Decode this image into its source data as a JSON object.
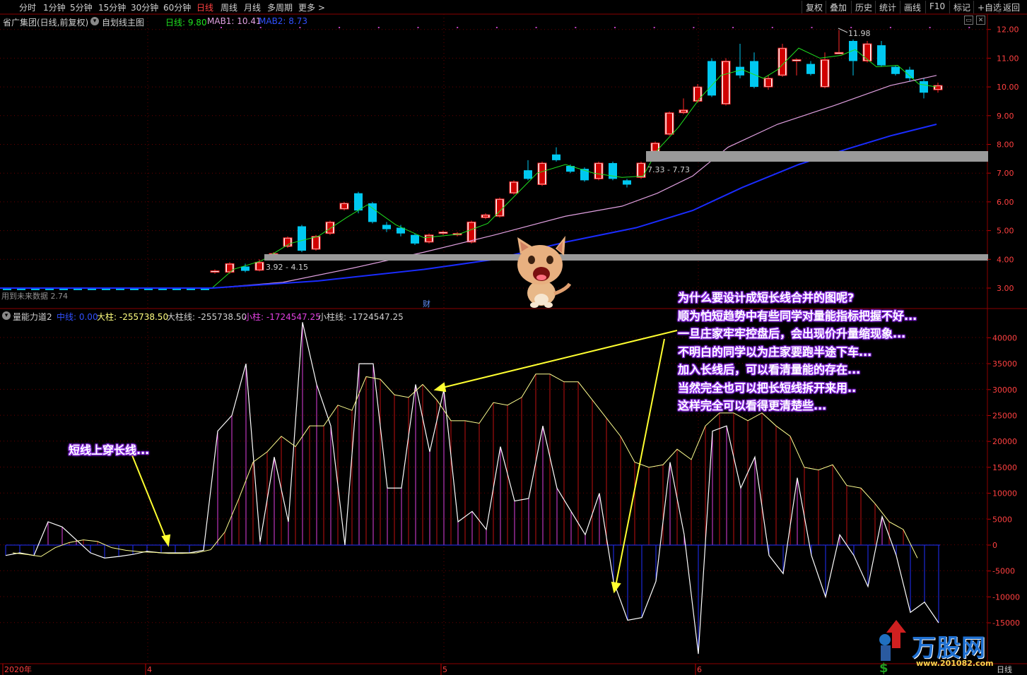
{
  "toolbar": {
    "periods": [
      "分时",
      "1分钟",
      "5分钟",
      "15分钟",
      "30分钟",
      "60分钟",
      "日线",
      "周线",
      "月线",
      "多周期",
      "更多 >"
    ],
    "active": "日线",
    "right": [
      "复权",
      "叠加",
      "历史",
      "统计",
      "画线",
      "F10",
      "标记",
      "+自选",
      "返回"
    ]
  },
  "main_header": {
    "stock": "省广集团(日线,前复权)",
    "template": "自划线主图",
    "ma_day": "日线: 9.80",
    "mab1": "MAB1: 10.41",
    "mab2": "MAB2: 8.73"
  },
  "price_axis": [
    "12.00",
    "11.00",
    "10.00",
    "9.00",
    "8.00",
    "7.00",
    "6.00",
    "5.00",
    "4.00",
    "3.00"
  ],
  "price_labels": {
    "high": "11.98",
    "band_low": "3.92 - 4.15",
    "band_high": "7.33 - 7.73",
    "bottom_left": "用到未来数据 2.74",
    "cai": "财"
  },
  "indicator_header": {
    "name": "量能力道2",
    "mid": "中线: 0.00",
    "dazhu": "大柱: -255738.50",
    "dazhuxian": "大柱线: -255738.50",
    "xiaozhu": "小柱: -1724547.25",
    "xiaozhuxian": "小柱线: -1724547.25"
  },
  "indicator_axis": [
    "40000",
    "35000",
    "30000",
    "25000",
    "20000",
    "15000",
    "10000",
    "5000",
    "0",
    "-5000",
    "-10000",
    "-15000"
  ],
  "date_axis": [
    "2020年",
    "4",
    "5",
    "6"
  ],
  "date_axis_right": "日线",
  "annotations": {
    "left": "短线上穿长线...",
    "right": [
      "为什么要设计成短长线合并的图呢?",
      "顺为怕短趋势中有些同学对量能指标把握不好...",
      "一旦庄家牢牢控盘后，会出现价升量缩现象...",
      "不明白的同学以为庄家要跑半途下车...",
      "加入长线后，可以看清量能的存在...",
      "当然完全也可以把长短线拆开来用..",
      "这样完全可以看得更清楚些..."
    ]
  },
  "watermark": {
    "name": "万股网",
    "url": "www.201082.com"
  },
  "colors": {
    "up": "#ff2a2a",
    "down": "#00c8f0",
    "short_line": "#ffffff",
    "long_line": "#ffff80",
    "mab1": "#e0a0e0",
    "mab2": "#1a2cff"
  }
}
